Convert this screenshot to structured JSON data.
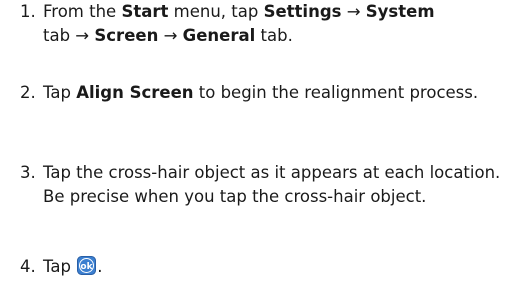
{
  "steps": [
    {
      "number": "1.",
      "t1": "From the ",
      "b1": "Start",
      "t2": " menu, tap ",
      "b2": "Settings",
      "a1": " → ",
      "b3": "System",
      "t3": " tab",
      "a2": " → ",
      "b4": "Screen",
      "a3": " → ",
      "b5": "General",
      "t4": " tab."
    },
    {
      "number": "2.",
      "t1": "Tap ",
      "b1": "Align Screen",
      "t2": " to begin the realignment process."
    },
    {
      "number": "3.",
      "text": "Tap the cross-hair object as it appears at each location. Be precise when you tap the cross-hair object."
    },
    {
      "number": "4.",
      "t1": "Tap ",
      "icon": "ok-button-icon",
      "t2": "."
    }
  ],
  "colors": {
    "text": "#1a1a1a",
    "ok_icon_bg": "#3b7fd0",
    "ok_icon_text": "#ffffff"
  }
}
